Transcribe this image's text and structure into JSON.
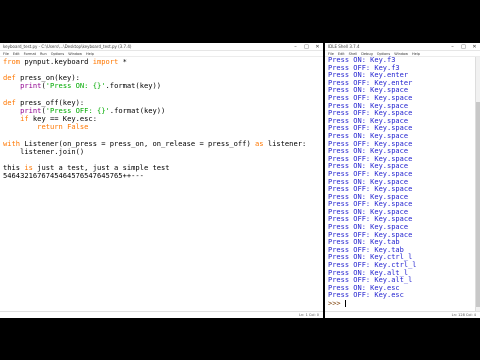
{
  "editor": {
    "title": "keyboard_test.py - C:\\Users\\...\\Desktop\\keyboard_test.py (3.7.4)",
    "menu": [
      "File",
      "Edit",
      "Format",
      "Run",
      "Options",
      "Window",
      "Help"
    ],
    "status": "Ln: 1  Col: 0",
    "lines": [
      {
        "parts": [
          {
            "t": "from",
            "c": "kw"
          },
          {
            "t": " pynput.keyboard "
          },
          {
            "t": "import",
            "c": "kw"
          },
          {
            "t": " *"
          }
        ]
      },
      {
        "parts": [
          {
            "t": ""
          }
        ]
      },
      {
        "parts": [
          {
            "t": "def",
            "c": "kw"
          },
          {
            "t": " press_on(key):"
          }
        ]
      },
      {
        "parts": [
          {
            "t": "    "
          },
          {
            "t": "print",
            "c": "bi"
          },
          {
            "t": "("
          },
          {
            "t": "'Press ON: {}'",
            "c": "st"
          },
          {
            "t": ".format(key))"
          }
        ]
      },
      {
        "parts": [
          {
            "t": ""
          }
        ]
      },
      {
        "parts": [
          {
            "t": "def",
            "c": "kw"
          },
          {
            "t": " press_off(key):"
          }
        ]
      },
      {
        "parts": [
          {
            "t": "    "
          },
          {
            "t": "print",
            "c": "bi"
          },
          {
            "t": "("
          },
          {
            "t": "'Press OFF: {}'",
            "c": "st"
          },
          {
            "t": ".format(key))"
          }
        ]
      },
      {
        "parts": [
          {
            "t": "    "
          },
          {
            "t": "if",
            "c": "kw"
          },
          {
            "t": " key == Key.esc:"
          }
        ]
      },
      {
        "parts": [
          {
            "t": "        "
          },
          {
            "t": "return",
            "c": "kw"
          },
          {
            "t": " "
          },
          {
            "t": "False",
            "c": "kw"
          }
        ]
      },
      {
        "parts": [
          {
            "t": ""
          }
        ]
      },
      {
        "parts": [
          {
            "t": "with",
            "c": "kw"
          },
          {
            "t": " Listener(on_press = press_on, on_release = press_off) "
          },
          {
            "t": "as",
            "c": "kw"
          },
          {
            "t": " listener:"
          }
        ]
      },
      {
        "parts": [
          {
            "t": "    listener.join()"
          }
        ]
      },
      {
        "parts": [
          {
            "t": ""
          }
        ]
      },
      {
        "parts": [
          {
            "t": "this "
          },
          {
            "t": "is",
            "c": "kw"
          },
          {
            "t": " just a test, just a simple test"
          }
        ]
      },
      {
        "parts": [
          {
            "t": "5464321676745464576547645765++---"
          }
        ]
      }
    ]
  },
  "shell": {
    "title": "IDLE Shell 3.7.4",
    "menu": [
      "File",
      "Edit",
      "Shell",
      "Debug",
      "Options",
      "Window",
      "Help"
    ],
    "status": "Ln: 128  Col: 4",
    "lines": [
      "Press ON: Key.f3",
      "Press OFF: Key.f3",
      "Press ON: Key.enter",
      "Press OFF: Key.enter",
      "Press ON: Key.space",
      "Press OFF: Key.space",
      "Press ON: Key.space",
      "Press OFF: Key.space",
      "Press ON: Key.space",
      "Press OFF: Key.space",
      "Press ON: Key.space",
      "Press OFF: Key.space",
      "Press ON: Key.space",
      "Press OFF: Key.space",
      "Press ON: Key.space",
      "Press OFF: Key.space",
      "Press ON: Key.space",
      "Press OFF: Key.space",
      "Press ON: Key.space",
      "Press OFF: Key.space",
      "Press ON: Key.space",
      "Press OFF: Key.space",
      "Press ON: Key.space",
      "Press OFF: Key.space",
      "Press ON: Key.tab",
      "Press OFF: Key.tab",
      "Press ON: Key.ctrl_l",
      "Press OFF: Key.ctrl_l",
      "Press ON: Key.alt_l",
      "Press OFF: Key.alt_l",
      "Press ON: Key.esc",
      "Press OFF: Key.esc"
    ],
    "prompt": ">>> "
  },
  "colors": {
    "keyword": "#ff7700",
    "builtin": "#900090",
    "string": "#00aa00",
    "shell_output": "#1f1fcf",
    "background": "#000000"
  }
}
